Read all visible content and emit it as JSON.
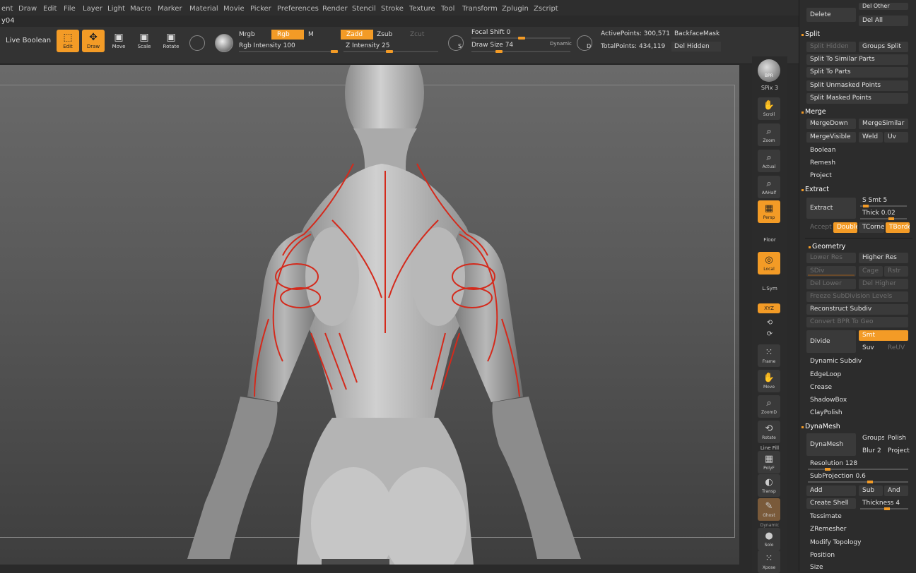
{
  "menu": [
    "ent",
    "Draw",
    "Edit",
    "File",
    "Layer",
    "Light",
    "Macro",
    "Marker",
    "Material",
    "Movie",
    "Picker",
    "Preferences",
    "Render",
    "Stencil",
    "Stroke",
    "Texture",
    "Tool",
    "Transform",
    "Zplugin",
    "Zscript"
  ],
  "doc_title": "y04",
  "shelf": {
    "live_boolean": "Live Boolean",
    "edit": "Edit",
    "draw": "Draw",
    "move": "Move",
    "scale": "Scale",
    "rotate": "Rotate",
    "mrgb": "Mrgb",
    "rgb": "Rgb",
    "m": "M",
    "zadd": "Zadd",
    "zsub": "Zsub",
    "zcut": "Zcut",
    "rgb_intensity": "Rgb Intensity 100",
    "z_intensity": "Z Intensity 25",
    "focal_shift": "Focal Shift 0",
    "draw_size": "Draw Size 74",
    "dynamic": "Dynamic",
    "active_points": "ActivePoints: 300,571",
    "total_points": "TotalPoints: 434,119",
    "backface_mask": "BackfaceMask",
    "del_hidden": "Del Hidden",
    "icon_s": "S",
    "icon_d": "D"
  },
  "right_shelf": {
    "bpr": "BPR",
    "spix": "SPix 3",
    "scroll": "Scroll",
    "zoom": "Zoom",
    "actual": "Actual",
    "aahalf": "AAHalf",
    "persp": "Persp",
    "floor": "Floor",
    "local": "Local",
    "lsym": "L.Sym",
    "xyz": "XYZ",
    "frame": "Frame",
    "move": "Move",
    "zoom3d": "ZoomD",
    "rotate": "Rotate",
    "line_fill": "Line Fill",
    "polyf": "PolyF",
    "transp": "Transp",
    "ghost": "Ghost",
    "dynamic": "Dynamic",
    "solo": "Solo",
    "xpose": "Xpose"
  },
  "palette": {
    "delete": "Delete",
    "del_other": "Del Other",
    "del_all": "Del All",
    "split": "Split",
    "split_hidden": "Split Hidden",
    "groups_split": "Groups Split",
    "split_similar": "Split To Similar Parts",
    "split_parts": "Split To Parts",
    "split_unmasked": "Split Unmasked Points",
    "split_masked": "Split Masked Points",
    "merge": "Merge",
    "merge_down": "MergeDown",
    "merge_similar": "MergeSimilar",
    "merge_visible": "MergeVisible",
    "weld": "Weld",
    "uv": "Uv",
    "boolean": "Boolean",
    "remesh": "Remesh",
    "project": "Project",
    "extract_h": "Extract",
    "extract": "Extract",
    "s_smt": "S Smt 5",
    "thick": "Thick 0.02",
    "accept": "Accept",
    "double": "Double",
    "tcorne": "TCorne",
    "tborde": "TBorde",
    "geometry": "Geometry",
    "lower_res": "Lower Res",
    "higher_res": "Higher Res",
    "sdiv": "SDiv",
    "cage": "Cage",
    "rstr": "Rstr",
    "del_lower": "Del Lower",
    "del_higher": "Del Higher",
    "freeze": "Freeze SubDivision Levels",
    "reconstruct": "Reconstruct Subdiv",
    "convert_bpr": "Convert BPR To Geo",
    "divide": "Divide",
    "smt": "Smt",
    "suv": "Suv",
    "reuv": "ReUV",
    "dynamic_subdiv": "Dynamic Subdiv",
    "edgeloop": "EdgeLoop",
    "crease": "Crease",
    "shadowbox": "ShadowBox",
    "claypolish": "ClayPolish",
    "dynamesh_h": "DynaMesh",
    "dynamesh": "DynaMesh",
    "groups": "Groups",
    "polish": "Polish",
    "blur": "Blur 2",
    "project2": "Project",
    "resolution": "Resolution 128",
    "subprojection": "SubProjection 0.6",
    "add": "Add",
    "sub": "Sub",
    "and": "And",
    "create_shell": "Create Shell",
    "thickness": "Thickness 4",
    "tessimate": "Tessimate",
    "zremesher": "ZRemesher",
    "modify_topology": "Modify Topology",
    "position": "Position",
    "size": "Size"
  },
  "colors": {
    "accent": "#f39b26",
    "sketch": "#d42a1c",
    "model": "#c8c8c8"
  }
}
